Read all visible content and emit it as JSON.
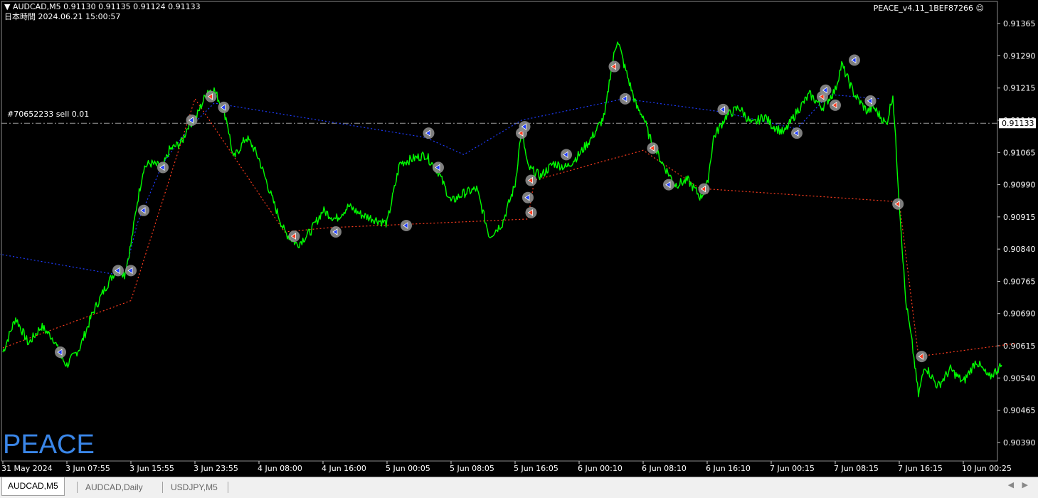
{
  "header": {
    "symbol_line": "▼ AUDCAD,M5  0.91130 0.91135 0.91124 0.91133",
    "datetime_line": "日本時間 2024.06.21 15:00:57",
    "ea_label": "PEACE_v4.11_1BEF87266 ☺",
    "order_label": "#70652233 sell 0.01"
  },
  "watermark": "PEACE",
  "tabs": [
    {
      "label": "AUDCAD,M5",
      "active": true
    },
    {
      "label": "AUDCAD,Daily",
      "active": false
    },
    {
      "label": "USDJPY,M5",
      "active": false
    }
  ],
  "tab_nav": "◀ ▶",
  "colors": {
    "price_line": "#00ff00",
    "buy_line": "#1e3cff",
    "sell_line": "#ff3c1e",
    "axis_text": "#ffffff",
    "current_price_box": "#ffffff",
    "watermark": "#3a86e8"
  },
  "chart_data": {
    "type": "line",
    "symbol": "AUDCAD",
    "timeframe": "M5",
    "current_price": 0.91133,
    "order_line": {
      "label": "#70652233 sell 0.01",
      "price": 0.91133
    },
    "ylim": [
      0.9035,
      0.9141
    ],
    "y_ticks": [
      "0.91365",
      "0.91290",
      "0.91215",
      "0.91140",
      "0.91065",
      "0.90990",
      "0.90915",
      "0.90840",
      "0.90765",
      "0.90690",
      "0.90615",
      "0.90540",
      "0.90465",
      "0.90390"
    ],
    "x_ticks": [
      "31 May 2024",
      "3 Jun 07:55",
      "3 Jun 15:55",
      "3 Jun 23:55",
      "4 Jun 08:00",
      "4 Jun 16:00",
      "5 Jun 00:05",
      "5 Jun 08:05",
      "5 Jun 16:05",
      "6 Jun 00:10",
      "6 Jun 08:10",
      "6 Jun 16:10",
      "7 Jun 00:15",
      "7 Jun 08:15",
      "7 Jun 16:15",
      "10 Jun 00:25"
    ],
    "x_positions": [
      0,
      1,
      2,
      3,
      4,
      5,
      6,
      7,
      8,
      9,
      10,
      11,
      12,
      13,
      14,
      15
    ],
    "series": [
      {
        "points": [
          [
            0.0,
            0.906
          ],
          [
            0.2,
            0.9068
          ],
          [
            0.4,
            0.9062
          ],
          [
            0.6,
            0.9066
          ],
          [
            0.8,
            0.9063
          ],
          [
            0.9,
            0.9059
          ],
          [
            1.0,
            0.9057
          ],
          [
            1.2,
            0.9061
          ],
          [
            1.4,
            0.9069
          ],
          [
            1.6,
            0.9075
          ],
          [
            1.8,
            0.908
          ],
          [
            1.9,
            0.9078
          ],
          [
            2.0,
            0.9085
          ],
          [
            2.1,
            0.9095
          ],
          [
            2.2,
            0.9103
          ],
          [
            2.3,
            0.9104
          ],
          [
            2.5,
            0.9103
          ],
          [
            2.6,
            0.9107
          ],
          [
            2.8,
            0.9109
          ],
          [
            2.9,
            0.9113
          ],
          [
            3.0,
            0.9114
          ],
          [
            3.2,
            0.9121
          ],
          [
            3.3,
            0.9121
          ],
          [
            3.4,
            0.9118
          ],
          [
            3.5,
            0.9114
          ],
          [
            3.6,
            0.9105
          ],
          [
            3.8,
            0.911
          ],
          [
            3.9,
            0.9108
          ],
          [
            4.0,
            0.9105
          ],
          [
            4.2,
            0.9096
          ],
          [
            4.4,
            0.9088
          ],
          [
            4.6,
            0.9085
          ],
          [
            4.8,
            0.9088
          ],
          [
            5.0,
            0.9093
          ],
          [
            5.2,
            0.9091
          ],
          [
            5.4,
            0.9094
          ],
          [
            5.6,
            0.9092
          ],
          [
            5.8,
            0.9091
          ],
          [
            6.0,
            0.909
          ],
          [
            6.2,
            0.9104
          ],
          [
            6.4,
            0.9105
          ],
          [
            6.6,
            0.9106
          ],
          [
            6.8,
            0.9102
          ],
          [
            7.0,
            0.9095
          ],
          [
            7.2,
            0.9097
          ],
          [
            7.4,
            0.9098
          ],
          [
            7.6,
            0.9087
          ],
          [
            7.8,
            0.909
          ],
          [
            8.0,
            0.9099
          ],
          [
            8.1,
            0.9112
          ],
          [
            8.2,
            0.9103
          ],
          [
            8.4,
            0.9101
          ],
          [
            8.6,
            0.9104
          ],
          [
            8.8,
            0.9103
          ],
          [
            9.0,
            0.9106
          ],
          [
            9.2,
            0.911
          ],
          [
            9.4,
            0.9115
          ],
          [
            9.5,
            0.9126
          ],
          [
            9.6,
            0.9133
          ],
          [
            9.7,
            0.9127
          ],
          [
            9.9,
            0.9117
          ],
          [
            10.0,
            0.9115
          ],
          [
            10.1,
            0.911
          ],
          [
            10.3,
            0.9104
          ],
          [
            10.5,
            0.9099
          ],
          [
            10.7,
            0.91
          ],
          [
            10.9,
            0.9096
          ],
          [
            11.0,
            0.9099
          ],
          [
            11.1,
            0.911
          ],
          [
            11.3,
            0.9115
          ],
          [
            11.5,
            0.9117
          ],
          [
            11.7,
            0.9113
          ],
          [
            11.9,
            0.9115
          ],
          [
            12.0,
            0.9113
          ],
          [
            12.2,
            0.9111
          ],
          [
            12.4,
            0.9116
          ],
          [
            12.6,
            0.912
          ],
          [
            12.8,
            0.9117
          ],
          [
            13.0,
            0.9121
          ],
          [
            13.1,
            0.9127
          ],
          [
            13.3,
            0.912
          ],
          [
            13.5,
            0.9116
          ],
          [
            13.6,
            0.9117
          ],
          [
            13.8,
            0.9113
          ],
          [
            13.9,
            0.912
          ],
          [
            14.0,
            0.9095
          ],
          [
            14.1,
            0.9072
          ],
          [
            14.2,
            0.9062
          ],
          [
            14.3,
            0.905
          ],
          [
            14.4,
            0.9057
          ],
          [
            14.6,
            0.9052
          ],
          [
            14.8,
            0.9056
          ],
          [
            15.0,
            0.9053
          ],
          [
            15.2,
            0.9058
          ],
          [
            15.4,
            0.9054
          ],
          [
            15.6,
            0.9057
          ]
        ]
      }
    ],
    "buy_path": [
      [
        -0.5,
        0.9084
      ],
      [
        1.8,
        0.9078
      ],
      [
        1.9,
        0.9078
      ],
      [
        2.1,
        0.909
      ],
      [
        2.5,
        0.9104
      ],
      [
        2.9,
        0.9112
      ],
      [
        3.3,
        0.9118
      ],
      [
        6.6,
        0.911
      ],
      [
        7.2,
        0.9106
      ],
      [
        8.1,
        0.9114
      ],
      [
        9.7,
        0.9119
      ],
      [
        11.2,
        0.9116
      ],
      [
        12.4,
        0.9112
      ],
      [
        12.9,
        0.912
      ],
      [
        13.7,
        0.9119
      ]
    ],
    "sell_path": [
      [
        0.0,
        0.9061
      ],
      [
        2.0,
        0.9072
      ],
      [
        3.0,
        0.9119
      ],
      [
        4.4,
        0.9088
      ],
      [
        5.1,
        0.9089
      ],
      [
        8.2,
        0.9091
      ],
      [
        8.3,
        0.91
      ],
      [
        10.0,
        0.9107
      ],
      [
        11.0,
        0.9097
      ],
      [
        11.0,
        0.9098
      ],
      [
        14.0,
        0.9095
      ],
      [
        14.3,
        0.9059
      ],
      [
        15.8,
        0.9062
      ]
    ],
    "signals": [
      {
        "x": 0.9,
        "y": 0.906,
        "side": "buy"
      },
      {
        "x": 1.8,
        "y": 0.9079,
        "side": "buy"
      },
      {
        "x": 2.0,
        "y": 0.9079,
        "side": "buy"
      },
      {
        "x": 2.2,
        "y": 0.9093,
        "side": "buy"
      },
      {
        "x": 2.5,
        "y": 0.9103,
        "side": "buy"
      },
      {
        "x": 2.95,
        "y": 0.9114,
        "side": "buy"
      },
      {
        "x": 3.25,
        "y": 0.91195,
        "side": "sell"
      },
      {
        "x": 3.45,
        "y": 0.9117,
        "side": "buy"
      },
      {
        "x": 4.55,
        "y": 0.9087,
        "side": "sell"
      },
      {
        "x": 5.2,
        "y": 0.9088,
        "side": "buy"
      },
      {
        "x": 6.3,
        "y": 0.90895,
        "side": "buy"
      },
      {
        "x": 6.65,
        "y": 0.9111,
        "side": "buy"
      },
      {
        "x": 6.8,
        "y": 0.9103,
        "side": "buy"
      },
      {
        "x": 8.1,
        "y": 0.9111,
        "side": "sell"
      },
      {
        "x": 8.15,
        "y": 0.91125,
        "side": "buy"
      },
      {
        "x": 8.2,
        "y": 0.9096,
        "side": "buy"
      },
      {
        "x": 8.25,
        "y": 0.91,
        "side": "sell"
      },
      {
        "x": 8.25,
        "y": 0.90925,
        "side": "sell"
      },
      {
        "x": 8.8,
        "y": 0.9106,
        "side": "buy"
      },
      {
        "x": 9.55,
        "y": 0.91265,
        "side": "sell"
      },
      {
        "x": 9.72,
        "y": 0.9119,
        "side": "buy"
      },
      {
        "x": 10.15,
        "y": 0.91075,
        "side": "sell"
      },
      {
        "x": 10.4,
        "y": 0.9099,
        "side": "buy"
      },
      {
        "x": 10.95,
        "y": 0.9098,
        "side": "sell"
      },
      {
        "x": 11.25,
        "y": 0.91165,
        "side": "buy"
      },
      {
        "x": 12.4,
        "y": 0.9111,
        "side": "buy"
      },
      {
        "x": 12.8,
        "y": 0.91195,
        "side": "sell"
      },
      {
        "x": 12.85,
        "y": 0.9121,
        "side": "buy"
      },
      {
        "x": 13.0,
        "y": 0.91175,
        "side": "sell"
      },
      {
        "x": 13.3,
        "y": 0.9128,
        "side": "buy"
      },
      {
        "x": 13.55,
        "y": 0.91185,
        "side": "buy"
      },
      {
        "x": 13.98,
        "y": 0.90945,
        "side": "sell"
      },
      {
        "x": 14.35,
        "y": 0.9059,
        "side": "sell"
      }
    ]
  }
}
